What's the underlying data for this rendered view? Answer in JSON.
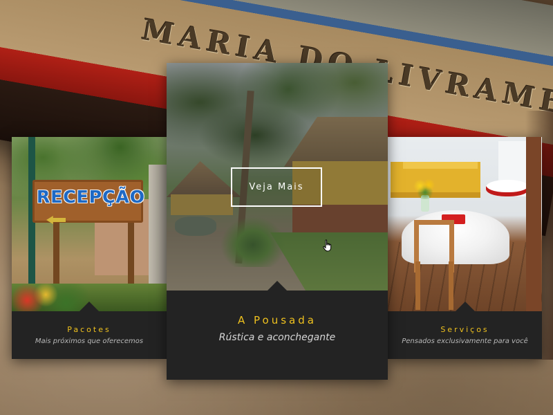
{
  "cards": {
    "left": {
      "title": "Pacotes",
      "subtitle": "Mais próximos que oferecemos",
      "photo_sign": "RECEPÇÃO"
    },
    "center": {
      "title": "A Pousada",
      "subtitle": "Rústica e aconchegante",
      "button_label": "Veja Mais"
    },
    "right": {
      "title": "Serviços",
      "subtitle": "Pensados exclusivamente para você"
    }
  },
  "background": {
    "boat_name": "MARIA DO LIVRAMENTO"
  },
  "colors": {
    "accent": "#f0c21e",
    "card_background": "#232323",
    "subtitle_text": "#b8b8b8"
  },
  "icons": {
    "cursor": "hand-pointer-icon"
  }
}
